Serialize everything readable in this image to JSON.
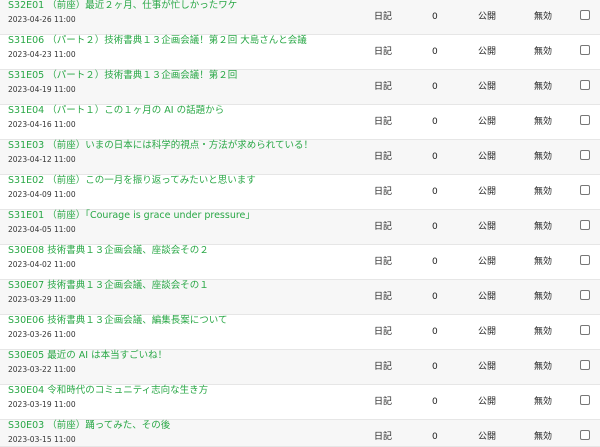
{
  "rows": [
    {
      "title": "S32E01 （前座）最近２ヶ月、仕事が忙しかったワケ",
      "date": "2023-04-26 11:00",
      "category": "日記",
      "count": "0",
      "status": "公開",
      "flag": "無効"
    },
    {
      "title": "S31E06 （パート２）技術書典１３企画会議！第２回 大島さんと会議",
      "date": "2023-04-23 11:00",
      "category": "日記",
      "count": "0",
      "status": "公開",
      "flag": "無効"
    },
    {
      "title": "S31E05 （パート２）技術書典１３企画会議！第２回",
      "date": "2023-04-19 11:00",
      "category": "日記",
      "count": "0",
      "status": "公開",
      "flag": "無効"
    },
    {
      "title": "S31E04 （パート１）この１ヶ月の AI の話題から",
      "date": "2023-04-16 11:00",
      "category": "日記",
      "count": "0",
      "status": "公開",
      "flag": "無効"
    },
    {
      "title": "S31E03 （前座）いまの日本には科学的視点・方法が求められている！",
      "date": "2023-04-12 11:00",
      "category": "日記",
      "count": "0",
      "status": "公開",
      "flag": "無効"
    },
    {
      "title": "S31E02 （前座）この一月を振り返ってみたいと思います",
      "date": "2023-04-09 11:00",
      "category": "日記",
      "count": "0",
      "status": "公開",
      "flag": "無効"
    },
    {
      "title": "S31E01 （前座）「Courage is grace under pressure」",
      "date": "2023-04-05 11:00",
      "category": "日記",
      "count": "0",
      "status": "公開",
      "flag": "無効"
    },
    {
      "title": "S30E08 技術書典１３企画会議、座談会その２",
      "date": "2023-04-02 11:00",
      "category": "日記",
      "count": "0",
      "status": "公開",
      "flag": "無効"
    },
    {
      "title": "S30E07 技術書典１３企画会議、座談会その１",
      "date": "2023-03-29 11:00",
      "category": "日記",
      "count": "0",
      "status": "公開",
      "flag": "無効"
    },
    {
      "title": "S30E06 技術書典１３企画会議、編集長案について",
      "date": "2023-03-26 11:00",
      "category": "日記",
      "count": "0",
      "status": "公開",
      "flag": "無効"
    },
    {
      "title": "S30E05 最近の AI は本当すごいね！",
      "date": "2023-03-22 11:00",
      "category": "日記",
      "count": "0",
      "status": "公開",
      "flag": "無効"
    },
    {
      "title": "S30E04 令和時代のコミュニティ志向な生き方",
      "date": "2023-03-19 11:00",
      "category": "日記",
      "count": "0",
      "status": "公開",
      "flag": "無効"
    },
    {
      "title": "S30E03 （前座）踊ってみた、その後",
      "date": "2023-03-15 11:00",
      "category": "日記",
      "count": "0",
      "status": "公開",
      "flag": "無効"
    }
  ]
}
